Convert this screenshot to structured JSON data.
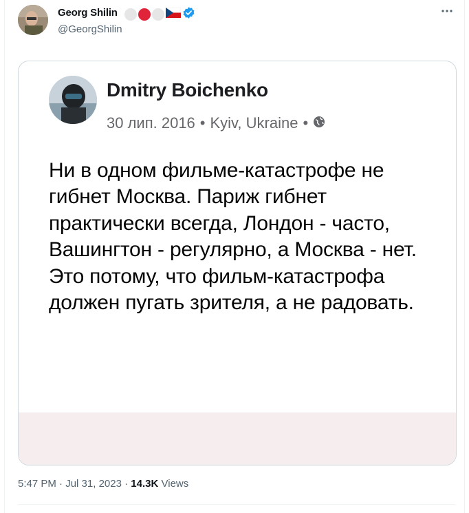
{
  "tweet": {
    "author": {
      "display_name": "Georg Shilin",
      "handle": "@GeorgShilin",
      "verified_icon": "verified-badge-icon",
      "badge_colors": [
        "#e6e6e6",
        "#e0243a",
        "#e6e6e6"
      ]
    },
    "more_icon": "more-options-icon",
    "time": "5:47 PM",
    "date": "Jul 31, 2023",
    "views_count": "14.3K",
    "views_label": "Views"
  },
  "embedded_post": {
    "author_name": "Dmitry Boichenko",
    "date": "30 лип. 2016",
    "location": "Kyiv, Ukraine",
    "privacy_icon": "globe-icon",
    "text": "Ни в одном фильме-катастрофе не гибнет Москва. Париж гибнет практически всегда, Лондон - часто, Вашингтон - регулярно, а Москва - нет. Это потому, что фильм-катастрофа должен пугать зрителя, а не радовать."
  },
  "colors": {
    "text_primary": "#0f1419",
    "text_secondary": "#536471",
    "verified_blue": "#1d9bf0",
    "card_border": "#cfd9de"
  }
}
